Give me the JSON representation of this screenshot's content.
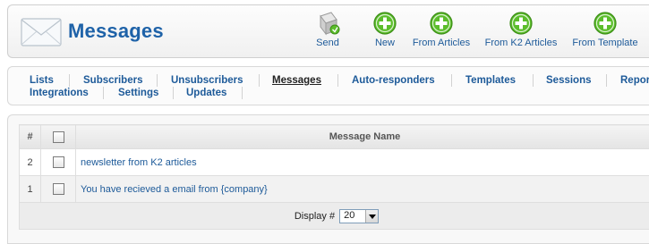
{
  "header": {
    "title": "Messages",
    "page_icon": "envelope-icon",
    "toolbar": [
      {
        "label": "Send",
        "icon": "send-mail-icon"
      },
      {
        "label": "New",
        "icon": "plus-circle-icon"
      },
      {
        "label": "From Articles",
        "icon": "plus-circle-icon"
      },
      {
        "label": "From K2 Articles",
        "icon": "plus-circle-icon"
      },
      {
        "label": "From Template",
        "icon": "plus-circle-icon"
      }
    ]
  },
  "nav": {
    "items": [
      {
        "label": "Lists"
      },
      {
        "label": "Subscribers"
      },
      {
        "label": "Unsubscribers"
      },
      {
        "label": "Messages",
        "active": true
      },
      {
        "label": "Auto-responders"
      },
      {
        "label": "Templates"
      },
      {
        "label": "Sessions"
      },
      {
        "label": "Repor"
      },
      {
        "label": "Integrations"
      },
      {
        "label": "Settings"
      },
      {
        "label": "Updates"
      }
    ]
  },
  "table": {
    "headers": {
      "num": "#",
      "name": "Message Name"
    },
    "rows": [
      {
        "num": "2",
        "name": "newsletter from K2 articles"
      },
      {
        "num": "1",
        "name": "You have recieved a email from {company}"
      }
    ],
    "footer": {
      "display_label": "Display #",
      "display_value": "20"
    }
  },
  "colors": {
    "accent": "#1e62a8",
    "link": "#1d5a99",
    "icon_green": "#5bbd2b"
  }
}
